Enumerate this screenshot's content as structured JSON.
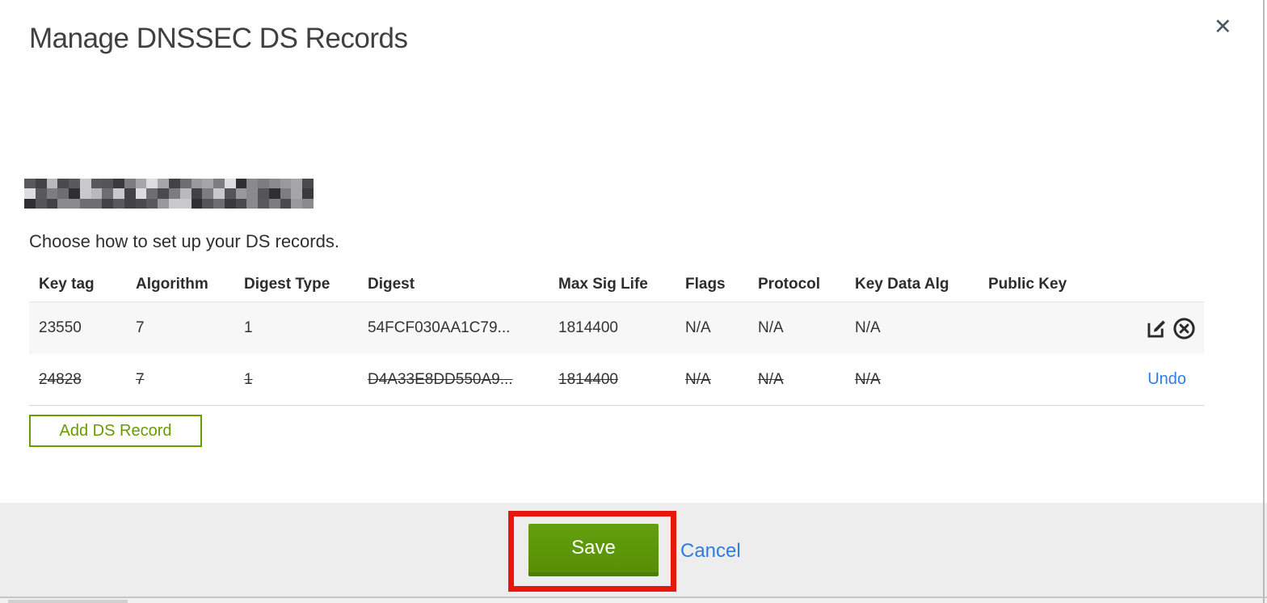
{
  "dialog": {
    "title": "Manage DNSSEC DS Records",
    "close_glyph": "✕",
    "instruction": "Choose how to set up your DS records.",
    "domain_name": "(redacted/pixelated domain name)"
  },
  "table": {
    "headers": [
      "Key tag",
      "Algorithm",
      "Digest Type",
      "Digest",
      "Max Sig Life",
      "Flags",
      "Protocol",
      "Key Data Alg",
      "Public Key"
    ],
    "rows": [
      {
        "state": "existing",
        "cells": [
          "23550",
          "7",
          "1",
          "54FCF030AA1C79...",
          "1814400",
          "N/A",
          "N/A",
          "N/A",
          ""
        ],
        "actions": [
          "edit-icon",
          "delete-icon"
        ]
      },
      {
        "state": "deleted",
        "cells": [
          "24828",
          "7",
          "1",
          "D4A33E8DD550A9...",
          "1814400",
          "N/A",
          "N/A",
          "N/A",
          ""
        ],
        "action_label": "Undo"
      }
    ]
  },
  "buttons": {
    "add_ds_record": "Add DS Record",
    "save": "Save",
    "cancel": "Cancel"
  },
  "colors": {
    "green_button_top": "#639f10",
    "green_button_bottom": "#578f04",
    "green_outline": "#679b00",
    "link_blue": "#2d7ce1",
    "annotation_red": "#e8170b",
    "footer_bg": "#ededed",
    "row_alt_bg": "#f7f7f7",
    "icon_dark": "#2b2b2b"
  },
  "redaction": {
    "cols": 26,
    "rows": 3,
    "palette": [
      "#3a3a3c",
      "#59595b",
      "#6e6e70",
      "#8a8a8c",
      "#a6a6a8",
      "#c9c9cb",
      "#4a4a4c",
      "#2f2f31",
      "#7d7d7f",
      "#b9b9bb",
      "#555557",
      "#99999b",
      "#dddddf",
      "#424244"
    ]
  }
}
